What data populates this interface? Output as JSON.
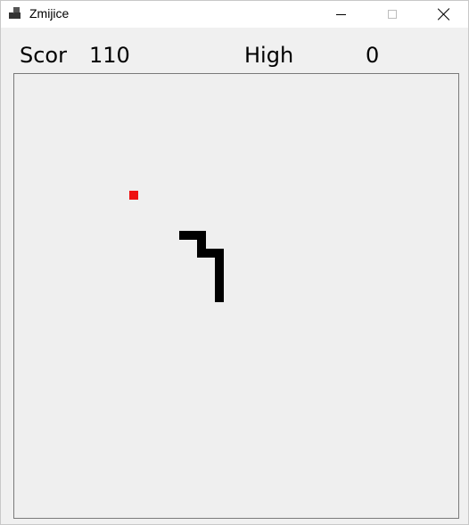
{
  "window": {
    "title": "Zmijice",
    "icon": "app-window-icon",
    "buttons": [
      "minimize-icon",
      "maximize-icon",
      "close-icon"
    ]
  },
  "scoreboard": {
    "score_label": "Scor",
    "score_value": "110",
    "high_label": "High",
    "high_value": "0"
  },
  "game": {
    "grid_cells": 50,
    "snake_color": "#000000",
    "food_color": "#ee1111",
    "board_background": "#efefef",
    "food": [
      13,
      13
    ],
    "snake": [
      [
        18,
        17
      ],
      [
        19,
        17
      ],
      [
        20,
        17
      ],
      [
        20,
        18
      ],
      [
        20,
        19
      ],
      [
        21,
        19
      ],
      [
        22,
        19
      ],
      [
        22,
        20
      ],
      [
        22,
        21
      ],
      [
        22,
        22
      ],
      [
        22,
        23
      ],
      [
        22,
        24
      ]
    ]
  }
}
